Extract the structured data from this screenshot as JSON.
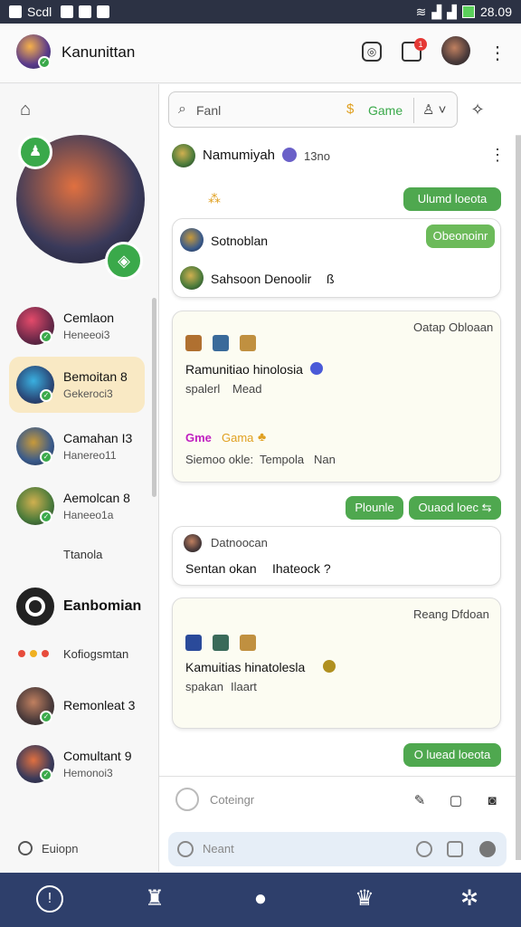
{
  "status_bar": {
    "left_text": "Scdl",
    "time": "28.09"
  },
  "header": {
    "title": "Kanunittan",
    "notification_count": "1"
  },
  "search": {
    "placeholder": "Fanl",
    "game_label": "Game"
  },
  "sidebar": {
    "chats": [
      {
        "name": "Cemlaon",
        "sub": "Heneeoi3"
      },
      {
        "name": "Bemoitan 8",
        "sub": "Gekeroci3"
      },
      {
        "name": "Camahan I3",
        "sub": "Hanereo11"
      },
      {
        "name": "Aemolcan 8",
        "sub": "Haneeo1a"
      },
      {
        "name": "Ttanola",
        "sub": ""
      },
      {
        "name": "Eanbomian",
        "sub": ""
      },
      {
        "name": "Kofiogsmtan",
        "sub": ""
      },
      {
        "name": "Remonleat 3",
        "sub": ""
      },
      {
        "name": "Comultant 9",
        "sub": "Hemonoi3"
      }
    ],
    "footer": "Euiopn"
  },
  "conversation": {
    "user_name": "Namumiyah",
    "user_meta": "13no",
    "pill1": "Ulumd loeota",
    "card1": {
      "pill": "Obeonoinr",
      "row1": "Sotnoblan",
      "row2": "Sahsoon Denoolir"
    },
    "card2": {
      "corner": "Oatap Obloaan",
      "title": "Ramunitiao hinolosia",
      "sub_a": "spalerl",
      "sub_b": "Mead",
      "game_a": "Gme",
      "game_b": "Gama",
      "line_a": "Siemoo okle:",
      "line_b": "Tempola",
      "line_c": "Nan"
    },
    "pill2": "Plounle",
    "pill3": "Ouaod loec",
    "card3": {
      "row1": "Datnoocan",
      "row2": "Sentan okan",
      "row2b": "Ihateock ?"
    },
    "card4": {
      "corner": "Reang Dfdoan",
      "title": "Kamuitias hinatolesla",
      "sub_a": "spakan",
      "sub_b": "Ilaart"
    },
    "pill4": "O luead loeota",
    "composer_placeholder": "Coteingr",
    "bottom_input_placeholder": "Neant"
  }
}
